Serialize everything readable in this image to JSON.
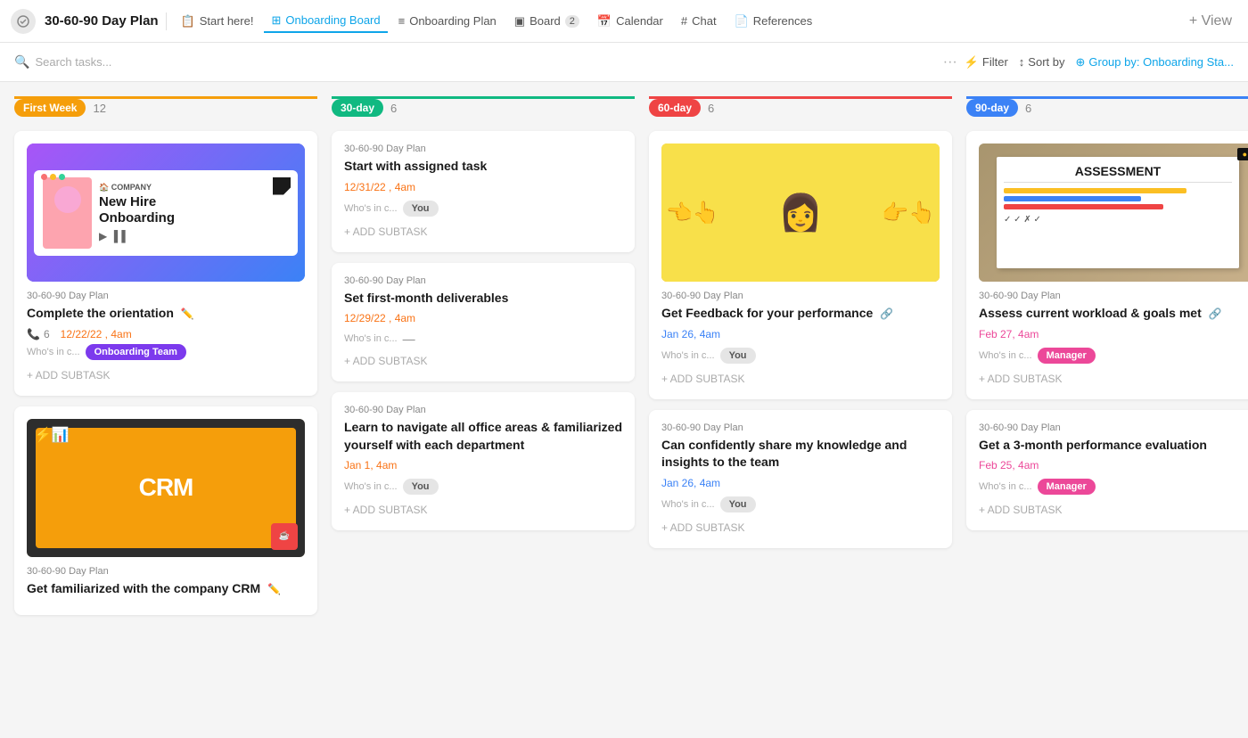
{
  "app": {
    "title": "30-60-90 Day Plan",
    "nav_items": [
      {
        "id": "start-here",
        "label": "Start here!",
        "icon": "📋",
        "active": false
      },
      {
        "id": "onboarding-board",
        "label": "Onboarding Board",
        "icon": "⊞",
        "active": true
      },
      {
        "id": "onboarding-plan",
        "label": "Onboarding Plan",
        "icon": "≡",
        "active": false
      },
      {
        "id": "board",
        "label": "Board",
        "icon": "▣",
        "active": false,
        "badge": "2"
      },
      {
        "id": "calendar",
        "label": "Calendar",
        "icon": "📅",
        "active": false
      },
      {
        "id": "chat",
        "label": "Chat",
        "icon": "#",
        "active": false
      },
      {
        "id": "references",
        "label": "References",
        "icon": "📄",
        "active": false
      }
    ],
    "plus_label": "+ View"
  },
  "toolbar": {
    "search_placeholder": "Search tasks...",
    "filter_label": "Filter",
    "sort_label": "Sort by",
    "group_label": "Group by: Onboarding Sta..."
  },
  "columns": [
    {
      "id": "first-week",
      "label": "First Week",
      "count": "12",
      "color": "#f59e0b",
      "badge_bg": "#f59e0b"
    },
    {
      "id": "30-day",
      "label": "30-day",
      "count": "6",
      "color": "#10b981",
      "badge_bg": "#10b981"
    },
    {
      "id": "60-day",
      "label": "60-day",
      "count": "6",
      "color": "#ef4444",
      "badge_bg": "#ef4444"
    },
    {
      "id": "90-day",
      "label": "90-day",
      "count": "6",
      "color": "#3b82f6",
      "badge_bg": "#3b82f6"
    }
  ],
  "cards": {
    "first_week": [
      {
        "id": "fw1",
        "type": "new-hire",
        "meta": "30-60-90 Day Plan",
        "title": "Complete the orientation",
        "has_attachment": true,
        "phone_count": "6",
        "date": "12/22/22 , 4am",
        "who_label": "Who's in c...",
        "tag": "Onboarding Team",
        "tag_class": "tag-purple",
        "add_subtask": "+ ADD SUBTASK"
      },
      {
        "id": "fw2",
        "type": "crm",
        "meta": "30-60-90 Day Plan",
        "title": "Get familiarized with the company CRM",
        "has_attachment": true
      }
    ],
    "day30": [
      {
        "id": "d30-1",
        "meta": "30-60-90 Day Plan",
        "title": "Start with assigned task",
        "date": "12/31/22 , 4am",
        "who_label": "Who's in c...",
        "tag": "You",
        "tag_class": "tag-gray",
        "add_subtask": "+ ADD SUBTASK"
      },
      {
        "id": "d30-2",
        "meta": "30-60-90 Day Plan",
        "title": "Set first-month deliverables",
        "date": "12/29/22 , 4am",
        "who_label": "Who's in c...",
        "who_value": "—",
        "add_subtask": "+ ADD SUBTASK"
      },
      {
        "id": "d30-3",
        "meta": "30-60-90 Day Plan",
        "title": "Learn to navigate all office areas & familiarized yourself with each department",
        "date": "Jan 1, 4am",
        "who_label": "Who's in c...",
        "tag": "You",
        "tag_class": "tag-gray",
        "add_subtask": "+ ADD SUBTASK"
      }
    ],
    "day60": [
      {
        "id": "d60-1",
        "type": "image",
        "meta": "30-60-90 Day Plan",
        "title": "Get Feedback for your performance",
        "has_attachment": true,
        "date": "Jan 26, 4am",
        "who_label": "Who's in c...",
        "tag": "You",
        "tag_class": "tag-gray",
        "add_subtask": "+ ADD SUBTASK"
      },
      {
        "id": "d60-2",
        "meta": "30-60-90 Day Plan",
        "title": "Can confidently share my knowledge and insights to the team",
        "date": "Jan 26, 4am",
        "who_label": "Who's in c...",
        "tag": "You",
        "tag_class": "tag-gray",
        "add_subtask": "+ ADD SUBTASK"
      }
    ],
    "day90": [
      {
        "id": "d90-1",
        "type": "assessment",
        "meta": "30-60-90 Day Plan",
        "title": "Assess current workload & goals met",
        "has_attachment": true,
        "date": "Feb 27, 4am",
        "who_label": "Who's in c...",
        "tag": "Manager",
        "tag_class": "tag-pink",
        "add_subtask": "+ ADD SUBTASK"
      },
      {
        "id": "d90-2",
        "meta": "30-60-90 Day Plan",
        "title": "Get a 3-month performance evaluation",
        "date": "Feb 25, 4am",
        "who_label": "Who's in c...",
        "tag": "Manager",
        "tag_class": "tag-pink",
        "add_subtask": "+ ADD SUBTASK"
      }
    ]
  }
}
